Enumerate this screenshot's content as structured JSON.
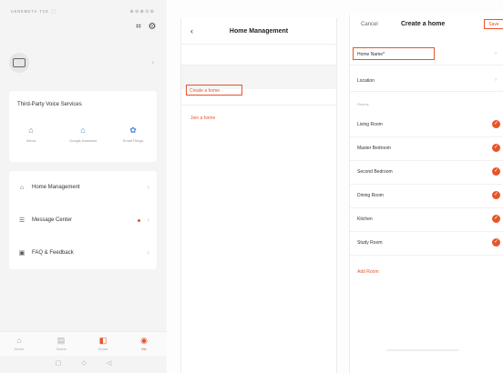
{
  "phone1": {
    "status": {
      "carrier": "ᴜᴋʀᴋᴍᴇᴛᴀ ᴛᴄᴇ ⬚",
      "right": "⊕ ⊖ ⊗ ⊙ ⊚"
    },
    "third_party": {
      "title": "Third-Party Voice Services",
      "services": [
        {
          "label": "Alexa",
          "icon": "echo-icon",
          "color": "#7a8a9a"
        },
        {
          "label": "Google Assistant",
          "icon": "google-home-icon",
          "color": "#4a86e8"
        },
        {
          "label": "SmartThings",
          "icon": "smartthings-icon",
          "color": "#4a86e8"
        }
      ]
    },
    "menu": [
      {
        "label": "Home Management",
        "icon": "home-icon",
        "dot": false
      },
      {
        "label": "Message Center",
        "icon": "message-icon",
        "dot": true
      },
      {
        "label": "FAQ & Feedback",
        "icon": "faq-icon",
        "dot": false
      }
    ],
    "tabs": [
      {
        "label": "Home",
        "icon": "home-tab-icon",
        "active": false
      },
      {
        "label": "Scene",
        "icon": "scene-tab-icon",
        "active": false
      },
      {
        "label": "Smart",
        "icon": "smart-tab-icon",
        "active": false
      },
      {
        "label": "Me",
        "icon": "me-tab-icon",
        "active": true
      }
    ]
  },
  "phone2": {
    "title": "Home Management",
    "create_home": "Create a home",
    "join_home": "Join a home"
  },
  "phone3": {
    "cancel": "Cancel",
    "title": "Create a home",
    "save": "Save",
    "home_name_label": "Home Name*",
    "location_label": "Location",
    "location_value": "",
    "rooms_section": "Rooms",
    "rooms": [
      "Living Room",
      "Master Bedroom",
      "Second Bedroom",
      "Dining Room",
      "Kitchen",
      "Study Room"
    ],
    "add_room": "Add Room"
  },
  "colors": {
    "accent": "#e8542a"
  }
}
